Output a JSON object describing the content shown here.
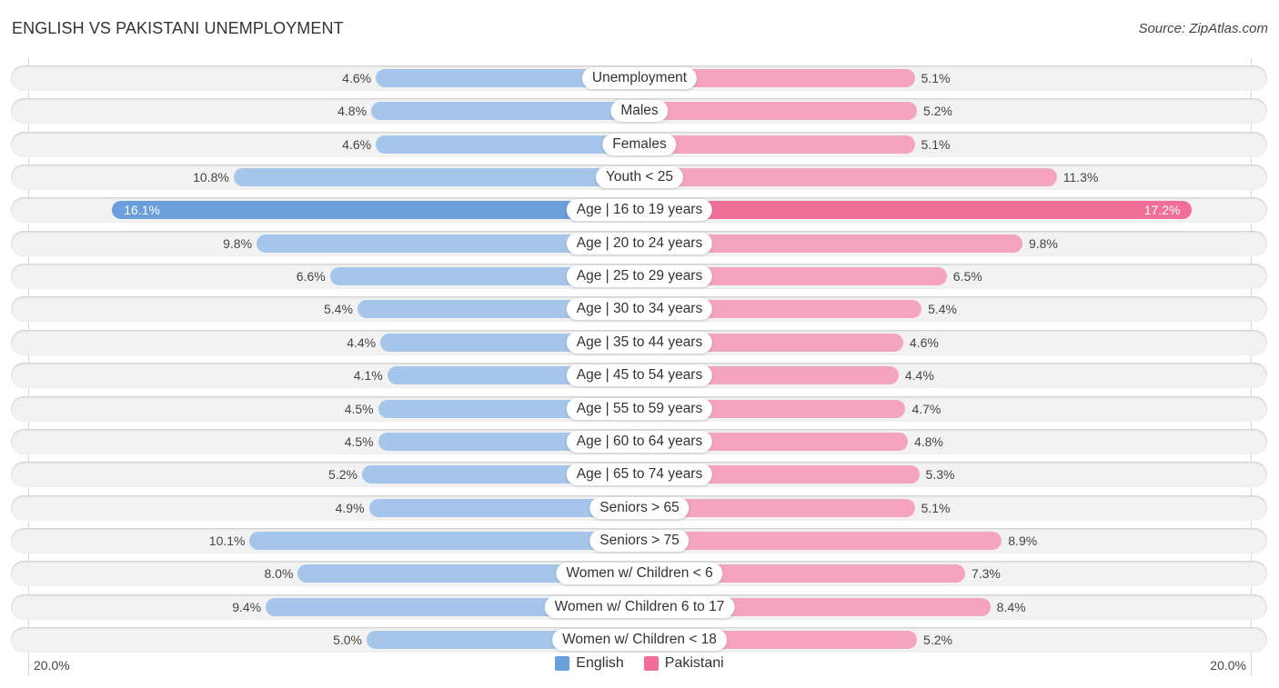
{
  "header": {
    "title": "ENGLISH VS PAKISTANI UNEMPLOYMENT",
    "source": "Source: ZipAtlas.com"
  },
  "chart_data": {
    "type": "bar",
    "orientation": "horizontal-diverging",
    "title": "ENGLISH VS PAKISTANI UNEMPLOYMENT",
    "xlabel": "",
    "ylabel": "",
    "xlim": [
      0,
      20.0
    ],
    "axis_tick_labels": {
      "left": "20.0%",
      "right": "20.0%"
    },
    "legend": {
      "placement": "bottom-center",
      "entries": [
        "English",
        "Pakistani"
      ]
    },
    "colors": {
      "English": "#a5c6ea",
      "English_highlight": "#6a9fdc",
      "Pakistani": "#f5a4c0",
      "Pakistani_highlight": "#f06e98"
    },
    "categories": [
      "Unemployment",
      "Males",
      "Females",
      "Youth < 25",
      "Age | 16 to 19 years",
      "Age | 20 to 24 years",
      "Age | 25 to 29 years",
      "Age | 30 to 34 years",
      "Age | 35 to 44 years",
      "Age | 45 to 54 years",
      "Age | 55 to 59 years",
      "Age | 60 to 64 years",
      "Age | 65 to 74 years",
      "Seniors > 65",
      "Seniors > 75",
      "Women w/ Children < 6",
      "Women w/ Children 6 to 17",
      "Women w/ Children < 18"
    ],
    "series": [
      {
        "name": "English",
        "unit": "%",
        "values": [
          4.6,
          4.8,
          4.6,
          10.8,
          16.1,
          9.8,
          6.6,
          5.4,
          4.4,
          4.1,
          4.5,
          4.5,
          5.2,
          4.9,
          10.1,
          8.0,
          9.4,
          5.0
        ],
        "labels": [
          "4.6%",
          "4.8%",
          "4.6%",
          "10.8%",
          "16.1%",
          "9.8%",
          "6.6%",
          "5.4%",
          "4.4%",
          "4.1%",
          "4.5%",
          "4.5%",
          "5.2%",
          "4.9%",
          "10.1%",
          "8.0%",
          "9.4%",
          "5.0%"
        ]
      },
      {
        "name": "Pakistani",
        "unit": "%",
        "values": [
          5.1,
          5.2,
          5.1,
          11.3,
          17.2,
          9.8,
          6.5,
          5.4,
          4.6,
          4.4,
          4.7,
          4.8,
          5.3,
          5.1,
          8.9,
          7.3,
          8.4,
          5.2
        ],
        "labels": [
          "5.1%",
          "5.2%",
          "5.1%",
          "11.3%",
          "17.2%",
          "9.8%",
          "6.5%",
          "5.4%",
          "4.6%",
          "4.4%",
          "4.7%",
          "4.8%",
          "5.3%",
          "5.1%",
          "8.9%",
          "7.3%",
          "8.4%",
          "5.2%"
        ]
      }
    ]
  }
}
